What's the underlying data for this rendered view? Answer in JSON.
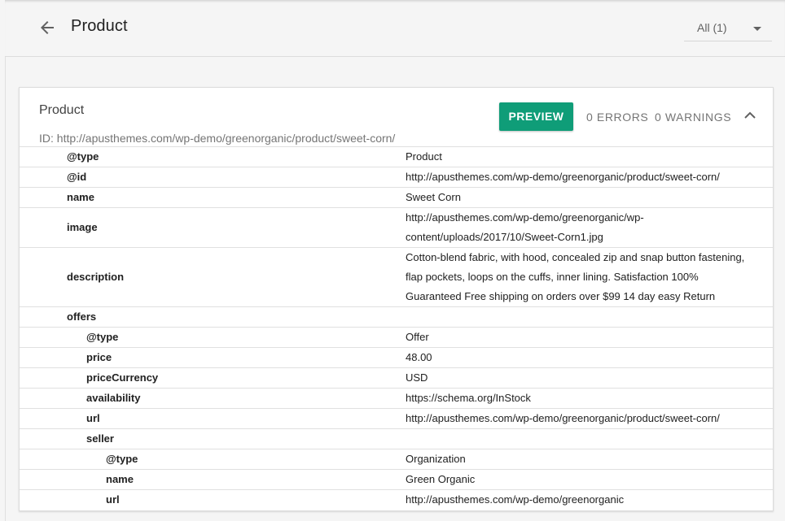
{
  "header": {
    "title": "Product",
    "filter_label": "All (1)"
  },
  "card": {
    "title": "Product",
    "id_line": "ID: http://apusthemes.com/wp-demo/greenorganic/product/sweet-corn/",
    "preview_label": "PREVIEW",
    "errors_label": "0 ERRORS",
    "warnings_label": "0 WARNINGS",
    "accent_color": "#0f9d78"
  },
  "properties": [
    {
      "key": "@type",
      "value": "Product",
      "level": 0
    },
    {
      "key": "@id",
      "value": "http://apusthemes.com/wp-demo/greenorganic/product/sweet-corn/",
      "level": 0
    },
    {
      "key": "name",
      "value": "Sweet Corn",
      "level": 0
    },
    {
      "key": "image",
      "value": "http://apusthemes.com/wp-demo/greenorganic/wp-content/uploads/2017/10/Sweet-Corn1.jpg",
      "level": 0
    },
    {
      "key": "description",
      "value": "Cotton-blend fabric, with hood, concealed zip and snap button fastening, flap pockets, loops on the cuffs, inner lining. Satisfaction 100% Guaranteed Free shipping on orders over $99 14 day easy Return",
      "level": 0
    },
    {
      "key": "offers",
      "value": "",
      "level": 0
    },
    {
      "key": "@type",
      "value": "Offer",
      "level": 1
    },
    {
      "key": "price",
      "value": "48.00",
      "level": 1
    },
    {
      "key": "priceCurrency",
      "value": "USD",
      "level": 1
    },
    {
      "key": "availability",
      "value": "https://schema.org/InStock",
      "level": 1
    },
    {
      "key": "url",
      "value": "http://apusthemes.com/wp-demo/greenorganic/product/sweet-corn/",
      "level": 1
    },
    {
      "key": "seller",
      "value": "",
      "level": 1
    },
    {
      "key": "@type",
      "value": "Organization",
      "level": 2
    },
    {
      "key": "name",
      "value": "Green Organic",
      "level": 2
    },
    {
      "key": "url",
      "value": "http://apusthemes.com/wp-demo/greenorganic",
      "level": 2
    }
  ]
}
